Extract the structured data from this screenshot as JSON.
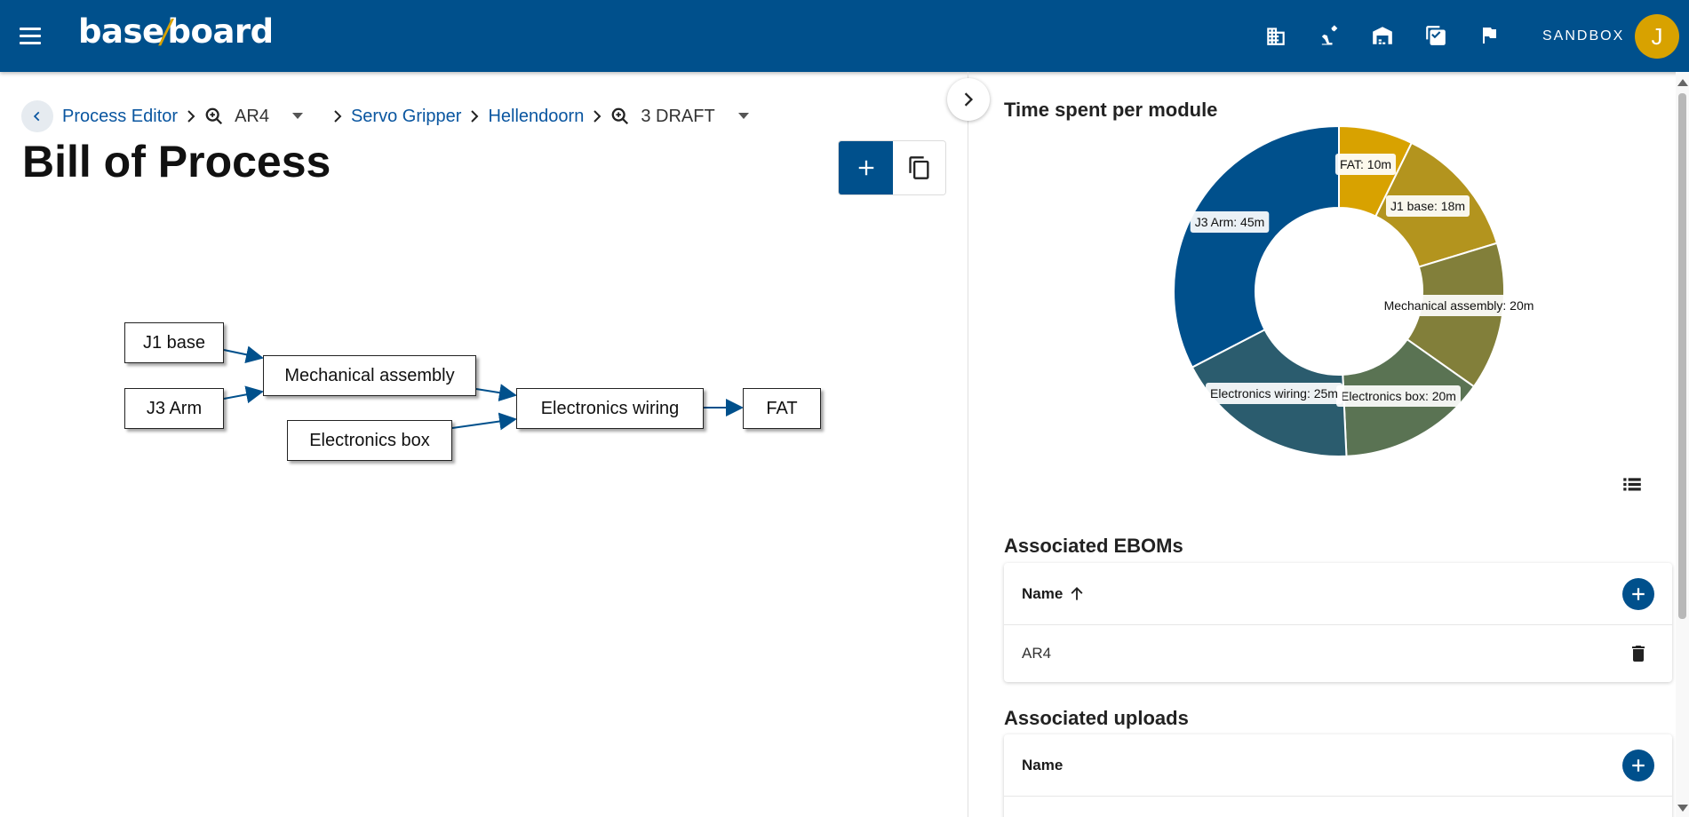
{
  "app": {
    "logo_base": "base",
    "logo_slash": "/",
    "logo_board": "board",
    "env_label": "SANDBOX",
    "user_initial": "J"
  },
  "nav_icons": [
    "building-icon",
    "robot-arm-icon",
    "warehouse-icon",
    "checklist-icon",
    "flag-icon"
  ],
  "breadcrumb": {
    "items": [
      {
        "label": "Process Editor",
        "type": "link"
      },
      {
        "label": "AR4",
        "type": "search-select"
      },
      {
        "label": "Servo Gripper",
        "type": "link"
      },
      {
        "label": "Hellendoorn",
        "type": "link"
      },
      {
        "label": "3 DRAFT",
        "type": "search-select"
      }
    ]
  },
  "page": {
    "title": "Bill of Process"
  },
  "flow": {
    "nodes": {
      "j1": "J1 base",
      "j3": "J3 Arm",
      "mech": "Mechanical assembly",
      "ebox": "Electronics box",
      "ewire": "Electronics wiring",
      "fat": "FAT"
    },
    "edges": [
      [
        "j1",
        "mech"
      ],
      [
        "j3",
        "mech"
      ],
      [
        "mech",
        "ewire"
      ],
      [
        "ebox",
        "ewire"
      ],
      [
        "ewire",
        "fat"
      ]
    ]
  },
  "colors": {
    "primary": "#00508c",
    "accent": "#d8a200"
  },
  "chart_data": {
    "type": "pie",
    "title": "Time spent per module",
    "slices": [
      {
        "label": "FAT: 10m",
        "value": 10,
        "color": "#d8a200"
      },
      {
        "label": "J1 base: 18m",
        "value": 18,
        "color": "#b3941e"
      },
      {
        "label": "Mechanical assembly: 20m",
        "value": 20,
        "color": "#827f3a"
      },
      {
        "label": "Electronics box: 20m",
        "value": 20,
        "color": "#5a7353"
      },
      {
        "label": "Electronics wiring: 25m",
        "value": 25,
        "color": "#2b5c6e"
      },
      {
        "label": "J3 Arm: 45m",
        "value": 45,
        "color": "#00508c"
      }
    ]
  },
  "ebom": {
    "title": "Associated EBOMs",
    "column": "Name",
    "rows": [
      "AR4"
    ]
  },
  "uploads": {
    "title": "Associated uploads",
    "column": "Name"
  }
}
